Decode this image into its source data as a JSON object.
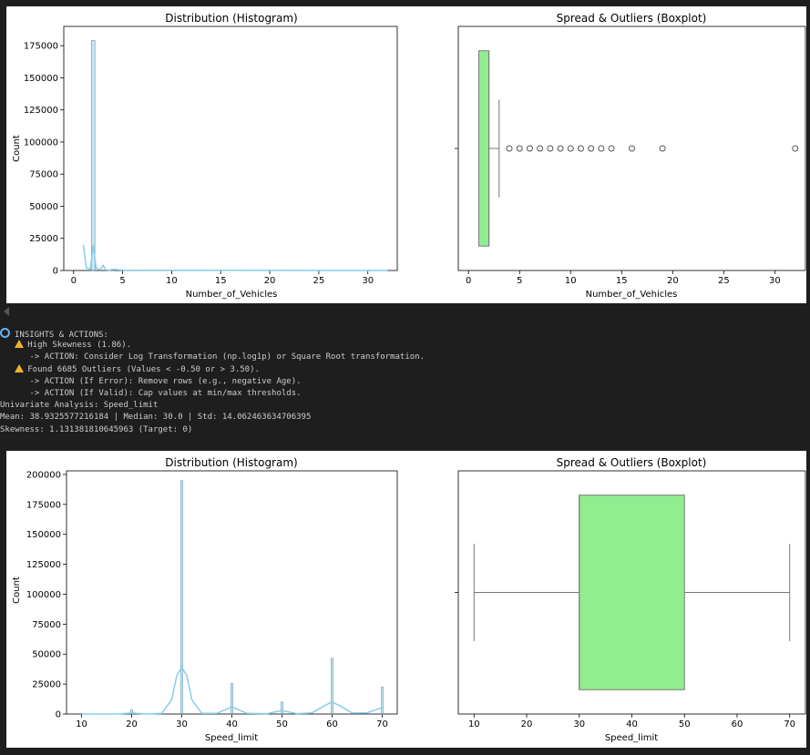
{
  "figure1": {
    "hist": {
      "title": "Distribution (Histogram)",
      "xlabel": "Number_of_Vehicles",
      "ylabel": "Count"
    },
    "box": {
      "title": "Spread & Outliers (Boxplot)",
      "xlabel": "Number_of_Vehicles"
    }
  },
  "console": {
    "lines": [
      {
        "icon": "magnifier-icon",
        "text": "INSIGHTS & ACTIONS:"
      },
      {
        "icon": "warning-icon",
        "indent": "   ",
        "text": "High Skewness (1.86)."
      },
      {
        "indent": "      ",
        "text": "-> ACTION: Consider Log Transformation (np.log1p) or Square Root transformation."
      },
      {
        "icon": "warning-icon",
        "indent": "   ",
        "text": "Found 6685 Outliers (Values < -0.50 or > 3.50)."
      },
      {
        "indent": "      ",
        "text": "-> ACTION (If Error): Remove rows (e.g., negative Age)."
      },
      {
        "indent": "      ",
        "text": "-> ACTION (If Valid): Cap values at min/max thresholds."
      },
      {
        "text": "Univariate Analysis: Speed_limit"
      },
      {
        "text": "Mean: 38.9325577216184 | Median: 30.0 | Std: 14.062463634706395"
      },
      {
        "text": "Skewness: 1.131381810645963 (Target: 0)"
      }
    ]
  },
  "figure2": {
    "hist": {
      "title": "Distribution (Histogram)",
      "xlabel": "Speed_limit",
      "ylabel": "Count"
    },
    "box": {
      "title": "Spread & Outliers (Boxplot)",
      "xlabel": "Speed_limit"
    }
  },
  "chart_data": [
    {
      "id": "vehicles-hist",
      "type": "bar",
      "title": "Distribution (Histogram)",
      "xlabel": "Number_of_Vehicles",
      "ylabel": "Count",
      "xlim": [
        -1,
        33
      ],
      "ylim": [
        0,
        190000
      ],
      "xticks": [
        0,
        5,
        10,
        15,
        20,
        25,
        30
      ],
      "yticks": [
        0,
        25000,
        50000,
        75000,
        100000,
        125000,
        150000,
        175000
      ],
      "bar_color": "#87ceeb",
      "bars": [
        {
          "x": 1,
          "y": 0
        },
        {
          "x": 2,
          "y": 179000
        },
        {
          "x": 3,
          "y": 0
        },
        {
          "x": 4,
          "y": 1000
        }
      ],
      "kde": [
        [
          1,
          20000
        ],
        [
          1.3,
          2000
        ],
        [
          1.7,
          1000
        ],
        [
          2,
          20000
        ],
        [
          2.3,
          2000
        ],
        [
          2.7,
          500
        ],
        [
          3,
          4000
        ],
        [
          3.3,
          500
        ],
        [
          3.7,
          300
        ],
        [
          4,
          1000
        ],
        [
          5,
          300
        ],
        [
          32,
          0
        ]
      ]
    },
    {
      "id": "vehicles-box",
      "type": "boxplot",
      "title": "Spread & Outliers (Boxplot)",
      "xlabel": "Number_of_Vehicles",
      "xlim": [
        -1,
        33
      ],
      "xticks": [
        0,
        5,
        10,
        15,
        20,
        25,
        30
      ],
      "box_color": "#90ee90",
      "q1": 1,
      "median": 2,
      "q3": 2,
      "whisker_low": 1,
      "whisker_high": 3,
      "outliers": [
        4,
        5,
        6,
        7,
        8,
        9,
        10,
        11,
        12,
        13,
        14,
        16,
        19,
        32
      ]
    },
    {
      "id": "speed-hist",
      "type": "bar",
      "title": "Distribution (Histogram)",
      "xlabel": "Speed_limit",
      "ylabel": "Count",
      "xlim": [
        7,
        73
      ],
      "ylim": [
        0,
        203000
      ],
      "xticks": [
        10,
        20,
        30,
        40,
        50,
        60,
        70
      ],
      "yticks": [
        0,
        25000,
        50000,
        75000,
        100000,
        125000,
        150000,
        175000,
        200000
      ],
      "bar_color": "#87ceeb",
      "bars": [
        {
          "x": 20,
          "y": 3500
        },
        {
          "x": 30,
          "y": 195000
        },
        {
          "x": 40,
          "y": 25500
        },
        {
          "x": 50,
          "y": 10000
        },
        {
          "x": 60,
          "y": 46500
        },
        {
          "x": 70,
          "y": 22500
        }
      ],
      "kde": [
        [
          10,
          0
        ],
        [
          17,
          0
        ],
        [
          20,
          800
        ],
        [
          23,
          0
        ],
        [
          26,
          500
        ],
        [
          28,
          12000
        ],
        [
          29,
          32000
        ],
        [
          30,
          39000
        ],
        [
          31,
          32000
        ],
        [
          32,
          12000
        ],
        [
          34,
          500
        ],
        [
          37,
          500
        ],
        [
          40,
          6000
        ],
        [
          43,
          500
        ],
        [
          47,
          300
        ],
        [
          50,
          3000
        ],
        [
          53,
          300
        ],
        [
          56,
          1000
        ],
        [
          58.5,
          7000
        ],
        [
          60,
          10000
        ],
        [
          61.5,
          7000
        ],
        [
          64,
          800
        ],
        [
          67,
          1000
        ],
        [
          69,
          4000
        ],
        [
          70,
          5000
        ]
      ]
    },
    {
      "id": "speed-box",
      "type": "boxplot",
      "title": "Spread & Outliers (Boxplot)",
      "xlabel": "Speed_limit",
      "xlim": [
        7,
        73
      ],
      "xticks": [
        10,
        20,
        30,
        40,
        50,
        60,
        70
      ],
      "box_color": "#90ee90",
      "q1": 30,
      "median": 30,
      "q3": 50,
      "whisker_low": 10,
      "whisker_high": 70,
      "outliers": []
    }
  ]
}
